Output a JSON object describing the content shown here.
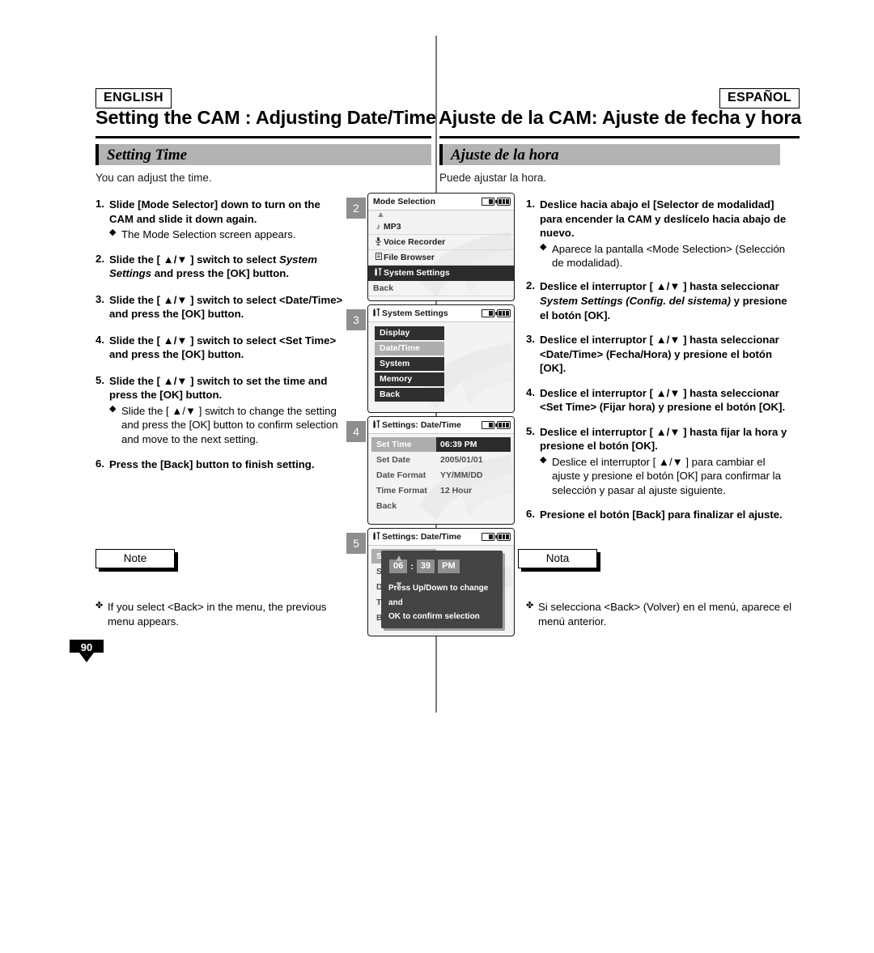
{
  "page": {
    "number": "90",
    "lang_en": "ENGLISH",
    "lang_es": "ESPAÑOL",
    "title_en": "Setting the CAM : Adjusting Date/Time",
    "title_es": "Ajuste de la CAM: Ajuste de fecha y hora",
    "section_en": "Setting Time",
    "section_es": "Ajuste de la hora",
    "intro_en": "You can adjust the time.",
    "intro_es": "Puede ajustar la hora."
  },
  "steps_en": [
    {
      "num": "1.",
      "text": "Slide [Mode Selector] down to turn on the CAM and slide it down again.",
      "sub": "The Mode Selection screen appears."
    },
    {
      "num": "2.",
      "text_before": "Slide the [ ▲/▼ ] switch to select ",
      "italic": "System Settings",
      "text_after": " and press the [OK] button.",
      "sub": ""
    },
    {
      "num": "3.",
      "text": "Slide the [ ▲/▼ ] switch to select <Date/Time> and press the [OK] button.",
      "sub": ""
    },
    {
      "num": "4.",
      "text": "Slide the [ ▲/▼ ] switch to select <Set Time> and press the [OK] button.",
      "sub": ""
    },
    {
      "num": "5.",
      "text": "Slide the [ ▲/▼ ] switch to set the time and press the [OK] button.",
      "sub": "Slide the [ ▲/▼ ] switch to change the setting and press the [OK] button to confirm selection and move to the next setting."
    },
    {
      "num": "6.",
      "text": "Press the [Back] button to finish setting.",
      "sub": ""
    }
  ],
  "steps_es": [
    {
      "num": "1.",
      "text": "Deslice hacia abajo el [Selector de modalidad] para encender la CAM y deslícelo hacia abajo de nuevo.",
      "sub": "Aparece la pantalla <Mode Selection> (Selección de modalidad)."
    },
    {
      "num": "2.",
      "text_before": "Deslice el interruptor [ ▲/▼ ] hasta seleccionar ",
      "italic": "System Settings (Config. del sistema)",
      "text_after": " y presione el botón [OK].",
      "sub": ""
    },
    {
      "num": "3.",
      "text": "Deslice el interruptor [ ▲/▼ ] hasta seleccionar <Date/Time> (Fecha/Hora) y presione el botón [OK].",
      "sub": ""
    },
    {
      "num": "4.",
      "text": "Deslice el interruptor [ ▲/▼ ] hasta seleccionar <Set Time> (Fijar hora) y presione el botón [OK].",
      "sub": ""
    },
    {
      "num": "5.",
      "text": "Deslice el interruptor [ ▲/▼ ] hasta fijar la hora y presione el botón [OK].",
      "sub": "Deslice el interruptor [ ▲/▼ ] para cambiar el ajuste y presione el botón [OK] para confirmar la selección y pasar al ajuste siguiente."
    },
    {
      "num": "6.",
      "text": "Presione el botón [Back] para finalizar el ajuste.",
      "sub": ""
    }
  ],
  "notes": {
    "label_en": "Note",
    "label_es": "Nota",
    "text_en": "If you select <Back> in the menu, the previous menu appears.",
    "text_es": "Si selecciona <Back> (Volver) en el menú, aparece el menú anterior."
  },
  "screens": [
    {
      "badge": "2",
      "title": "Mode Selection",
      "has_title_icon": false,
      "rows": [
        {
          "icon": "♪",
          "label": "MP3",
          "state": "normal"
        },
        {
          "icon": "♁",
          "label": "Voice Recorder",
          "state": "normal"
        },
        {
          "icon": "☰",
          "label": "File Browser",
          "state": "normal"
        },
        {
          "icon": "tools",
          "label": "System Settings",
          "state": "selected"
        },
        {
          "icon": "",
          "label": "Back",
          "state": "plain"
        }
      ]
    },
    {
      "badge": "3",
      "title": "System Settings",
      "has_title_icon": true,
      "buttons": [
        {
          "label": "Display",
          "state": "normal"
        },
        {
          "label": "Date/Time",
          "state": "highlight"
        },
        {
          "label": "System",
          "state": "normal"
        },
        {
          "label": "Memory",
          "state": "normal"
        },
        {
          "label": "Back",
          "state": "normal"
        }
      ]
    },
    {
      "badge": "4",
      "title": "Settings: Date/Time",
      "has_title_icon": true,
      "pairs": [
        {
          "key": "Set Time",
          "value": "06:39 PM",
          "state": "selected"
        },
        {
          "key": "Set Date",
          "value": "2005/01/01",
          "state": "normal"
        },
        {
          "key": "Date Format",
          "value": "YY/MM/DD",
          "state": "normal"
        },
        {
          "key": "Time Format",
          "value": "12 Hour",
          "state": "normal"
        },
        {
          "key": "Back",
          "value": "",
          "state": "normal"
        }
      ]
    },
    {
      "badge": "5",
      "title": "Settings: Date/Time",
      "has_title_icon": true,
      "pairs": [
        {
          "key": "S",
          "value": "",
          "state": "selected"
        },
        {
          "key": "S",
          "value": "",
          "state": "normal"
        },
        {
          "key": "D",
          "value": "",
          "state": "normal"
        },
        {
          "key": "T",
          "value": "",
          "state": "normal"
        },
        {
          "key": "B",
          "value": "",
          "state": "normal"
        }
      ],
      "overlay": {
        "hour": "06",
        "colon": ":",
        "minute": "39",
        "meridiem": "PM",
        "hint_line1": "Press Up/Down to change and",
        "hint_line2": "OK to confirm selection",
        "arrow_up": "▲",
        "arrow_down": "▼"
      }
    }
  ]
}
